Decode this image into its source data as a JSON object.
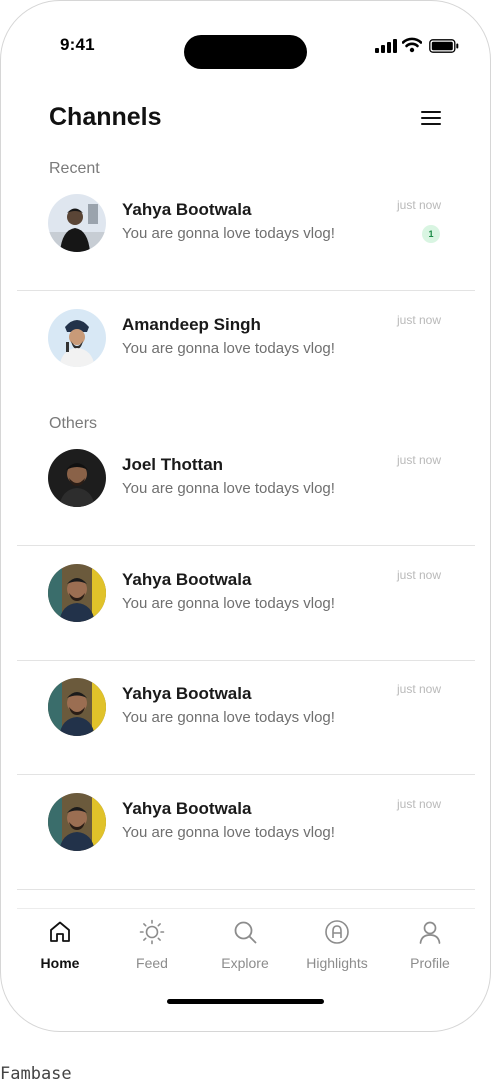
{
  "status_bar": {
    "time": "9:41",
    "icons": [
      "cellular-signal-icon",
      "wifi-icon",
      "battery-icon"
    ]
  },
  "header": {
    "title": "Channels",
    "menu_icon": "hamburger-menu-icon"
  },
  "sections": {
    "recent_label": "Recent",
    "others_label": "Others"
  },
  "channels": [
    {
      "name": "Yahya Bootwala",
      "message": "You are gonna love todays vlog!",
      "time": "just now",
      "unread": "1",
      "section": "Recent"
    },
    {
      "name": "Amandeep Singh",
      "message": "You are gonna love todays vlog!",
      "time": "just now",
      "section": "Recent"
    },
    {
      "name": "Joel Thottan",
      "message": "You are gonna love todays vlog!",
      "time": "just now",
      "section": "Others"
    },
    {
      "name": "Yahya Bootwala",
      "message": "You are gonna love todays vlog!",
      "time": "just now",
      "section": "Others"
    },
    {
      "name": "Yahya Bootwala",
      "message": "You are gonna love todays vlog!",
      "time": "just now",
      "section": "Others"
    },
    {
      "name": "Yahya Bootwala",
      "message": "You are gonna love todays vlog!",
      "time": "just now",
      "section": "Others"
    }
  ],
  "tab_bar": {
    "active": "Home",
    "tabs": [
      {
        "label": "Home",
        "icon": "home-icon"
      },
      {
        "label": "Feed",
        "icon": "sun-icon"
      },
      {
        "label": "Explore",
        "icon": "search-icon"
      },
      {
        "label": "Highlights",
        "icon": "highlights-icon"
      },
      {
        "label": "Profile",
        "icon": "user-icon"
      }
    ]
  },
  "colors": {
    "text_primary": "#111111",
    "text_secondary": "#6f6f6f",
    "timestamp": "#b9b9b9",
    "badge_bg": "#d9f5e2",
    "badge_text": "#1b8a46",
    "divider": "#e3e3e3"
  },
  "caption": "Fambase"
}
